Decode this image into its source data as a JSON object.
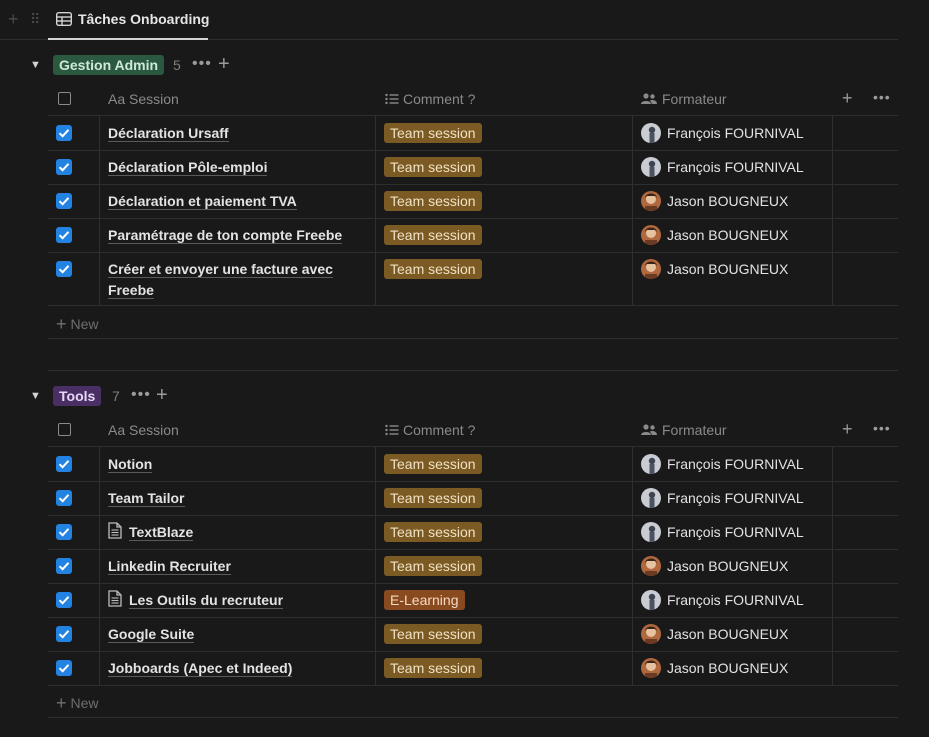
{
  "tab": {
    "label": "Tâches Onboarding"
  },
  "columns": {
    "session": "Aa Session",
    "comment": "Comment ?",
    "formateur": "Formateur"
  },
  "new_label": "New",
  "groups": [
    {
      "name": "Gestion Admin",
      "count": "5",
      "tag_color": "#2b593f",
      "tag_text_color": "#cfe8d8",
      "rows": [
        {
          "session": "Déclaration Ursaff",
          "comment": "Team session",
          "formateur": "François FOURNIVAL",
          "checked": true
        },
        {
          "session": "Déclaration Pôle-emploi",
          "comment": "Team session",
          "formateur": "François FOURNIVAL",
          "checked": true
        },
        {
          "session": "Déclaration et paiement TVA",
          "comment": "Team session",
          "formateur": "Jason BOUGNEUX",
          "checked": true
        },
        {
          "session": "Paramétrage de ton compte Freebe",
          "comment": "Team session",
          "formateur": "Jason BOUGNEUX",
          "checked": true
        },
        {
          "session": "Créer et envoyer une facture avec",
          "session_line2": "Freebe",
          "comment": "Team session",
          "formateur": "Jason BOUGNEUX",
          "checked": true
        }
      ]
    },
    {
      "name": "Tools",
      "count": "7",
      "tag_color": "#492f64",
      "tag_text_color": "#e7d9f5",
      "rows": [
        {
          "session": "Notion",
          "comment": "Team session",
          "formateur": "François FOURNIVAL",
          "checked": true
        },
        {
          "session": "Team Tailor",
          "comment": "Team session",
          "formateur": "François FOURNIVAL",
          "checked": true
        },
        {
          "session": "TextBlaze",
          "comment": "Team session",
          "formateur": "François FOURNIVAL",
          "checked": true,
          "icon": "document-icon"
        },
        {
          "session": "Linkedin Recruiter",
          "comment": "Team session",
          "formateur": "Jason BOUGNEUX",
          "checked": true
        },
        {
          "session": "Les Outils du recruteur",
          "comment": "E-Learning",
          "formateur": "François FOURNIVAL",
          "checked": true,
          "icon": "document-icon"
        },
        {
          "session": "Google Suite",
          "comment": "Team session",
          "formateur": "Jason BOUGNEUX",
          "checked": true
        },
        {
          "session": "Jobboards (Apec et Indeed)",
          "comment": "Team session",
          "formateur": "Jason BOUGNEUX",
          "checked": true
        }
      ]
    }
  ]
}
